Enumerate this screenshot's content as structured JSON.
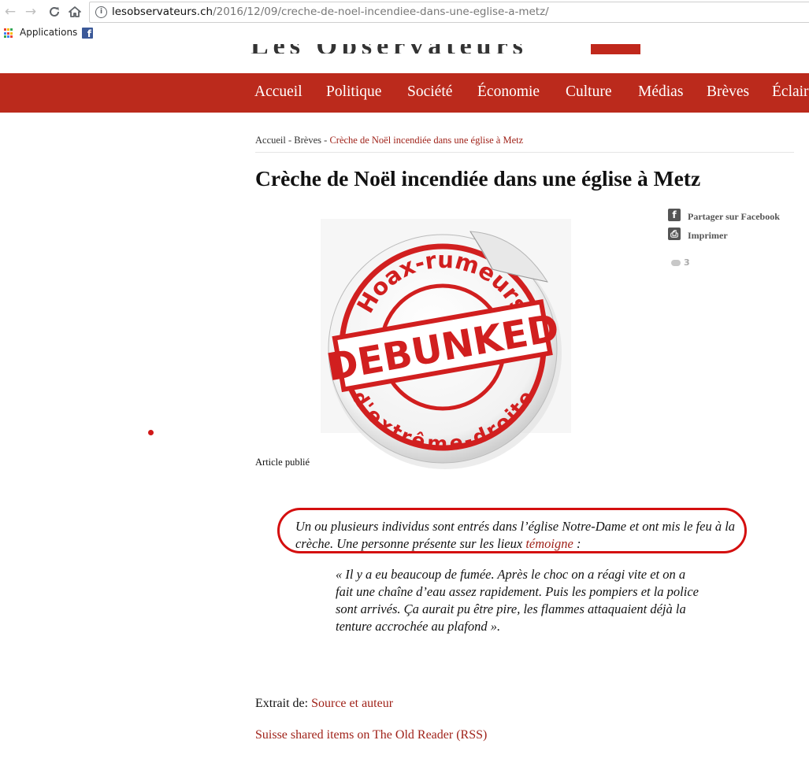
{
  "browser": {
    "url_domain": "lesobservateurs.ch",
    "url_path": "/2016/12/09/creche-de-noel-incendiee-dans-une-eglise-a-metz/",
    "bookmarks": {
      "apps_label": "Applications"
    }
  },
  "site": {
    "nav_items": [
      "Accueil",
      "Politique",
      "Société",
      "Économie",
      "Culture",
      "Médias",
      "Brèves",
      "Éclair"
    ]
  },
  "breadcrumb": {
    "home": "Accueil",
    "sep": " - ",
    "section": "Brèves",
    "current": "Crèche de Noël incendiée dans une église à Metz"
  },
  "article": {
    "title": "Crèche de Noël incendiée dans une église à Metz",
    "share_facebook": "Partager sur Facebook",
    "print": "Imprimer",
    "comments_count": "3",
    "published_fragment": "Article publié",
    "sticker": {
      "top_text": "Hoax-rumeurs",
      "center_text": "DEBUNKED",
      "bottom_text": "d'extrême-droite"
    },
    "intro_text": "Un ou plusieurs individus sont entrés dans l’église Notre-Dame et ont mis le feu à la crèche. Une personne présente sur les lieux ",
    "intro_link": "témoigne",
    "intro_end": " :",
    "quote": "« Il y a eu beaucoup de fumée. Après le choc on a réagi vite et on a fait une chaîne d’eau assez rapidement. Puis les pompiers et la police sont arrivés. Ça aurait pu être pire, les flammes attaquaient déjà la tenture accrochée au plafond ».",
    "source_prefix": "Extrait de: ",
    "source_link": "Source et auteur",
    "shared_link": "Suisse shared items on The Old Reader (RSS)"
  },
  "colors": {
    "nav_red": "#bb2a1c",
    "link_red": "#a0231a",
    "annotation_red": "#d40f0f",
    "stamp_red": "#d11f1f"
  }
}
